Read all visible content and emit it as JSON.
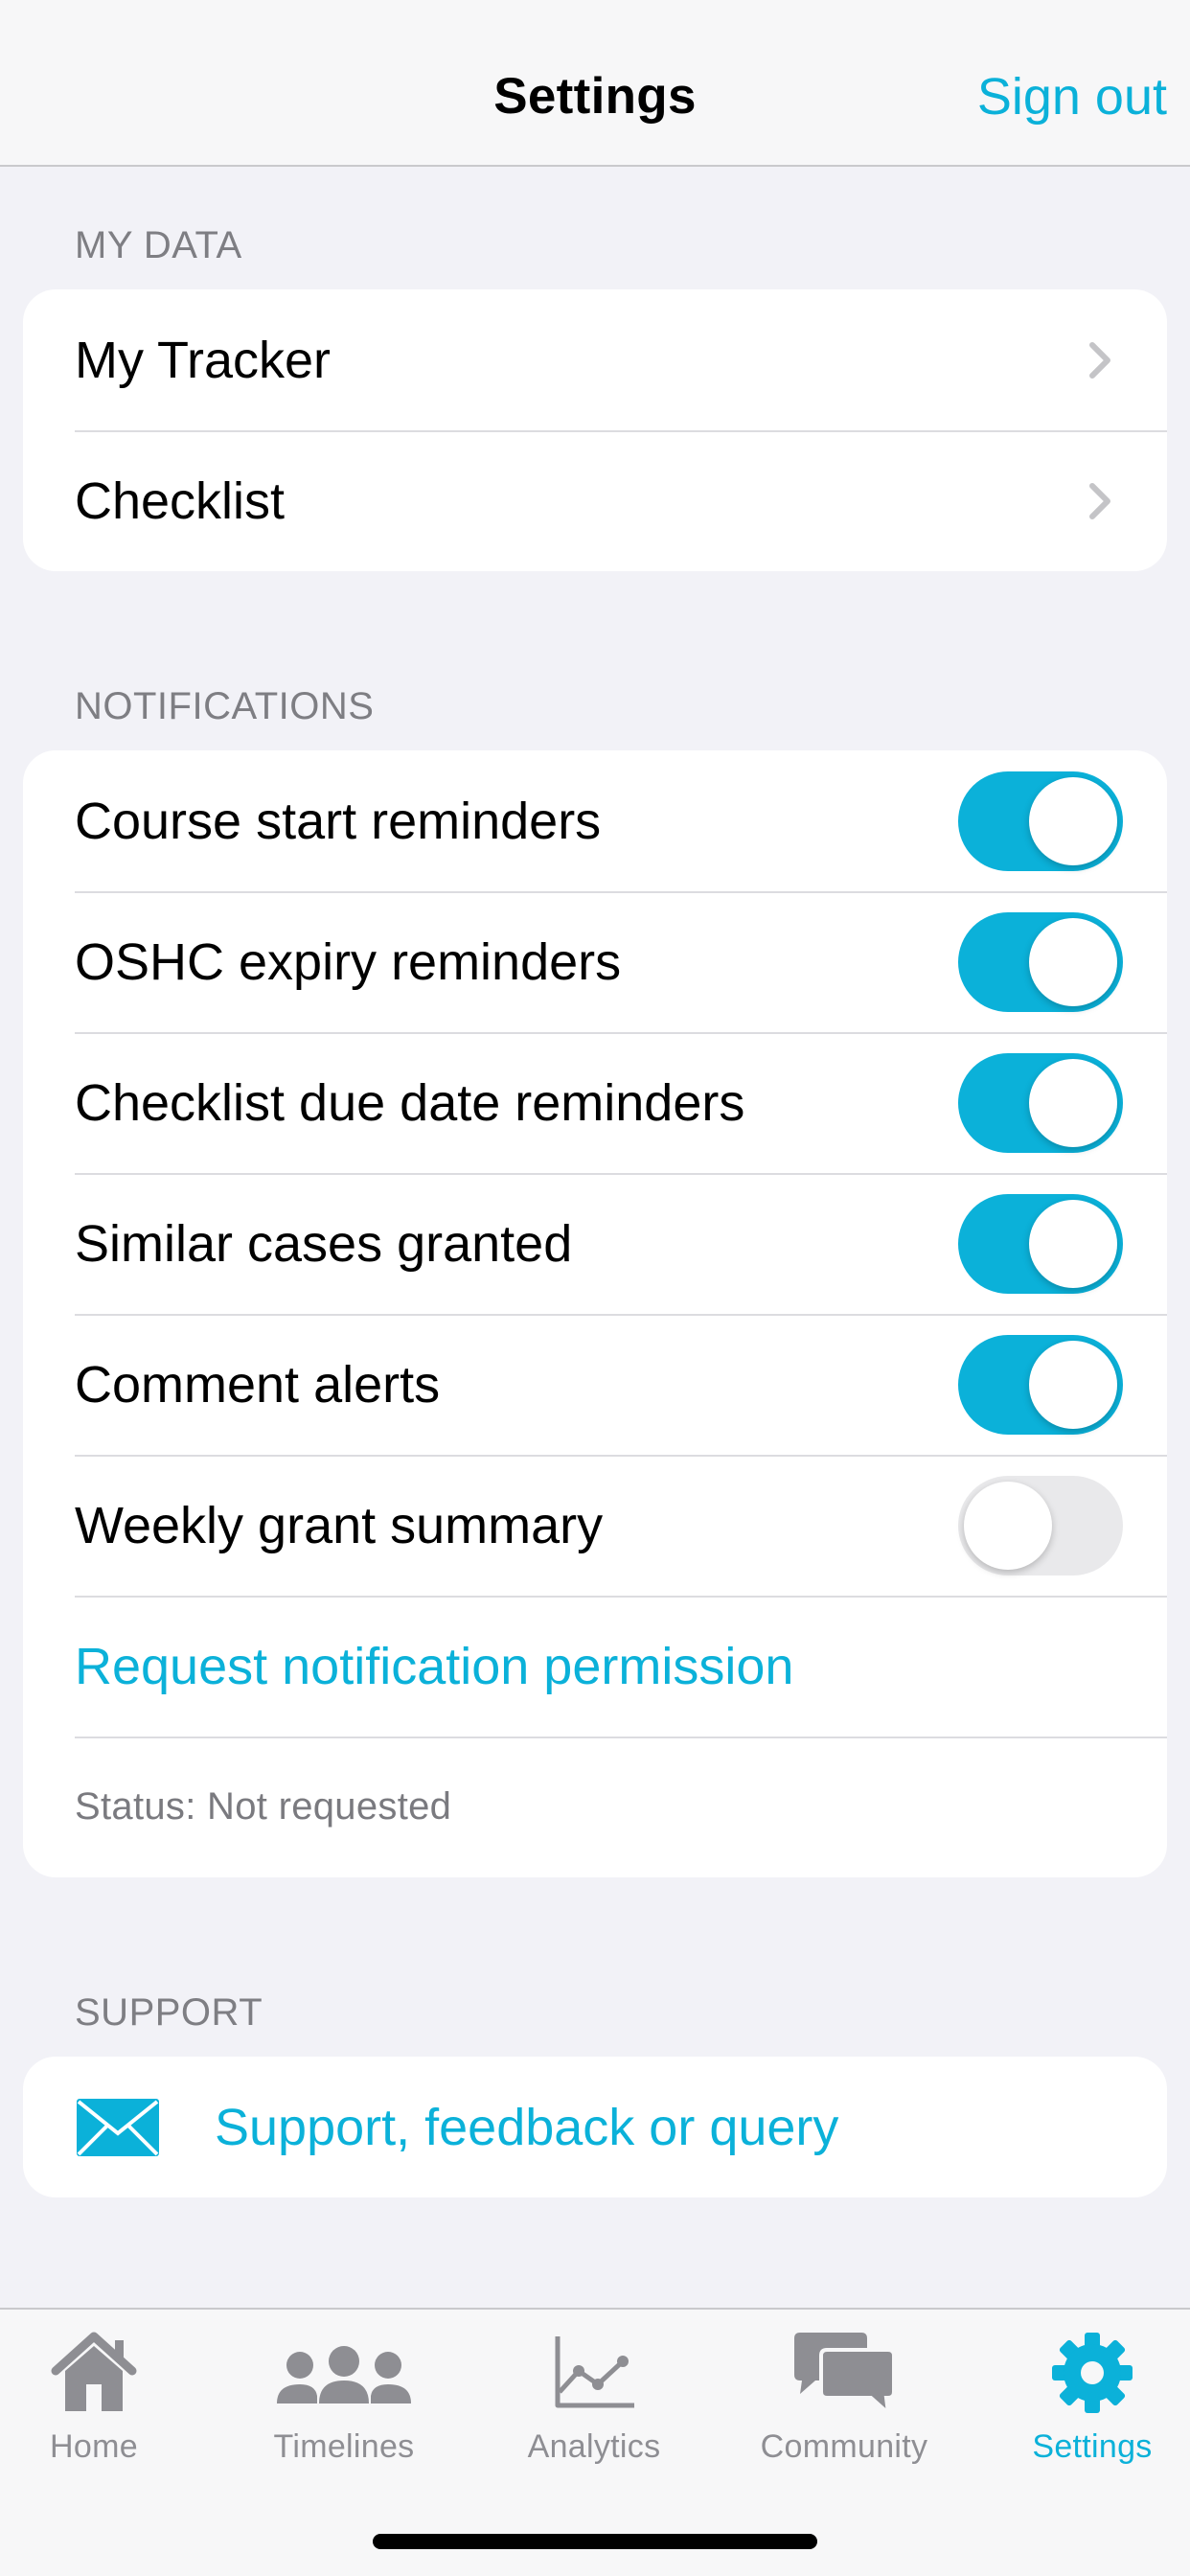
{
  "navbar": {
    "title": "Settings",
    "sign_out": "Sign out"
  },
  "sections": {
    "my_data": {
      "header": "MY DATA",
      "items": [
        {
          "label": "My Tracker"
        },
        {
          "label": "Checklist"
        }
      ]
    },
    "notifications": {
      "header": "NOTIFICATIONS",
      "toggles": [
        {
          "label": "Course start reminders",
          "on": true
        },
        {
          "label": "OSHC expiry reminders",
          "on": true
        },
        {
          "label": "Checklist due date reminders",
          "on": true
        },
        {
          "label": "Similar cases granted",
          "on": true
        },
        {
          "label": "Comment alerts",
          "on": true
        },
        {
          "label": "Weekly grant summary",
          "on": false
        }
      ],
      "request_permission": "Request notification permission",
      "status": "Status: Not requested"
    },
    "support": {
      "header": "SUPPORT",
      "item": {
        "label": "Support, feedback or query",
        "icon": "envelope-icon"
      }
    }
  },
  "tabbar": {
    "tabs": [
      {
        "label": "Home",
        "icon": "home-icon",
        "active": false
      },
      {
        "label": "Timelines",
        "icon": "people-icon",
        "active": false
      },
      {
        "label": "Analytics",
        "icon": "line-chart-icon",
        "active": false
      },
      {
        "label": "Community",
        "icon": "chat-bubbles-icon",
        "active": false
      },
      {
        "label": "Settings",
        "icon": "gear-icon",
        "active": true
      }
    ]
  },
  "colors": {
    "accent": "#0bb1d9",
    "toggle_off": "#e9e9eb",
    "inactive_tab": "#8e8e93"
  }
}
